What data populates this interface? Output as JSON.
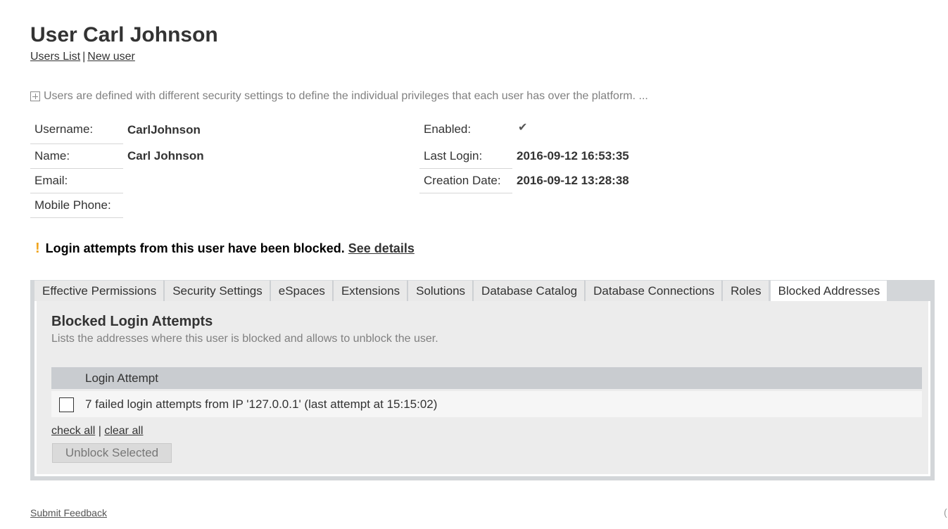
{
  "page": {
    "title": "User Carl Johnson",
    "links": {
      "users_list": "Users List",
      "separator": "|",
      "new_user": "New user"
    }
  },
  "intro": {
    "icon": "plus-box-icon",
    "text": "Users are defined with different security settings to define the individual privileges that each user has over the platform. ..."
  },
  "user_info": {
    "username": {
      "label": "Username:",
      "value": "CarlJohnson"
    },
    "name": {
      "label": "Name:",
      "value": "Carl Johnson"
    },
    "email": {
      "label": "Email:",
      "value": ""
    },
    "mobile_phone": {
      "label": "Mobile Phone:",
      "value": ""
    },
    "enabled": {
      "label": "Enabled:",
      "value": "✔",
      "icon": "checkmark-icon"
    },
    "last_login": {
      "label": "Last Login:",
      "value": "2016-09-12 16:53:35"
    },
    "creation_date": {
      "label": "Creation Date:",
      "value": "2016-09-12 13:28:38"
    }
  },
  "alert": {
    "icon": "exclamation-icon",
    "icon_glyph": "!",
    "icon_color": "#f0a41c",
    "text": "Login attempts from this user have been blocked.",
    "link": "See details"
  },
  "tabs": [
    {
      "label": "Effective Permissions",
      "active": false
    },
    {
      "label": "Security Settings",
      "active": false
    },
    {
      "label": "eSpaces",
      "active": false
    },
    {
      "label": "Extensions",
      "active": false
    },
    {
      "label": "Solutions",
      "active": false
    },
    {
      "label": "Database Catalog",
      "active": false
    },
    {
      "label": "Database Connections",
      "active": false
    },
    {
      "label": "Roles",
      "active": false
    },
    {
      "label": "Blocked Addresses",
      "active": true
    }
  ],
  "blocked": {
    "title": "Blocked Login Attempts",
    "description": "Lists the addresses where this user is blocked and allows to unblock the user.",
    "table": {
      "header": "Login Attempt",
      "rows": [
        {
          "checked": false,
          "text": "7 failed login attempts from IP '127.0.0.1' (last attempt at 15:15:02)"
        }
      ]
    },
    "check_all": "check all",
    "separator": "|",
    "clear_all": "clear all",
    "unblock_button": "Unblock Selected"
  },
  "footer": {
    "feedback": "Submit Feedback",
    "edge_glyph": "("
  }
}
